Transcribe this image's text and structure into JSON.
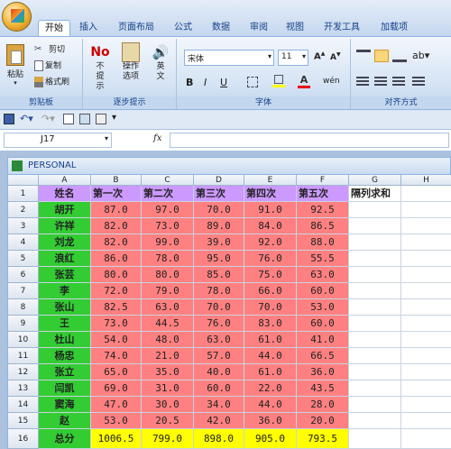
{
  "ribbon_tabs": [
    "开始",
    "插入",
    "页面布局",
    "公式",
    "数据",
    "审阅",
    "视图",
    "开发工具",
    "加载项"
  ],
  "clipboard": {
    "paste": "粘贴",
    "cut": "剪切",
    "copy": "复制",
    "format_painter": "格式刷",
    "group": "剪贴板"
  },
  "tips": {
    "no_tip_icon": "No",
    "no_tip": "不提示",
    "op_options": "操作选项",
    "english": "英文",
    "group": "逐步提示"
  },
  "font": {
    "name": "宋体",
    "size": "11",
    "group": "字体"
  },
  "alignment": {
    "group": "对齐方式"
  },
  "name_box": "J17",
  "fx": "fx",
  "workbook_title": "PERSONAL",
  "col_headers": [
    "A",
    "B",
    "C",
    "D",
    "E",
    "F",
    "G",
    "H"
  ],
  "header_row": [
    "姓名",
    "第一次",
    "第二次",
    "第三次",
    "第四次",
    "第五次",
    "隔列求和"
  ],
  "rows": [
    [
      "胡开",
      "87.0",
      "97.0",
      "70.0",
      "91.0",
      "92.5"
    ],
    [
      "许祥",
      "82.0",
      "73.0",
      "89.0",
      "84.0",
      "86.5"
    ],
    [
      "刘龙",
      "82.0",
      "99.0",
      "39.0",
      "92.0",
      "88.0"
    ],
    [
      "浪红",
      "86.0",
      "78.0",
      "95.0",
      "76.0",
      "55.5"
    ],
    [
      "张芸",
      "80.0",
      "80.0",
      "85.0",
      "75.0",
      "63.0"
    ],
    [
      "李",
      "72.0",
      "79.0",
      "78.0",
      "66.0",
      "60.0"
    ],
    [
      "张山",
      "82.5",
      "63.0",
      "70.0",
      "70.0",
      "53.0"
    ],
    [
      "王",
      "73.0",
      "44.5",
      "76.0",
      "83.0",
      "60.0"
    ],
    [
      "杜山",
      "54.0",
      "48.0",
      "63.0",
      "61.0",
      "41.0"
    ],
    [
      "杨忠",
      "74.0",
      "21.0",
      "57.0",
      "44.0",
      "66.5"
    ],
    [
      "张立",
      "65.0",
      "35.0",
      "40.0",
      "61.0",
      "36.0"
    ],
    [
      "闫凯",
      "69.0",
      "31.0",
      "60.0",
      "22.0",
      "43.5"
    ],
    [
      "窦海",
      "47.0",
      "30.0",
      "34.0",
      "44.0",
      "28.0"
    ],
    [
      "赵",
      "53.0",
      "20.5",
      "42.0",
      "36.0",
      "20.0"
    ]
  ],
  "total_row": [
    "总分",
    "1006.5",
    "799.0",
    "898.0",
    "905.0",
    "793.5"
  ],
  "colors": {
    "name_col": "#33cc33",
    "data": "#ff8080",
    "header_row": "#cc99ff",
    "total": "#ffff00"
  }
}
